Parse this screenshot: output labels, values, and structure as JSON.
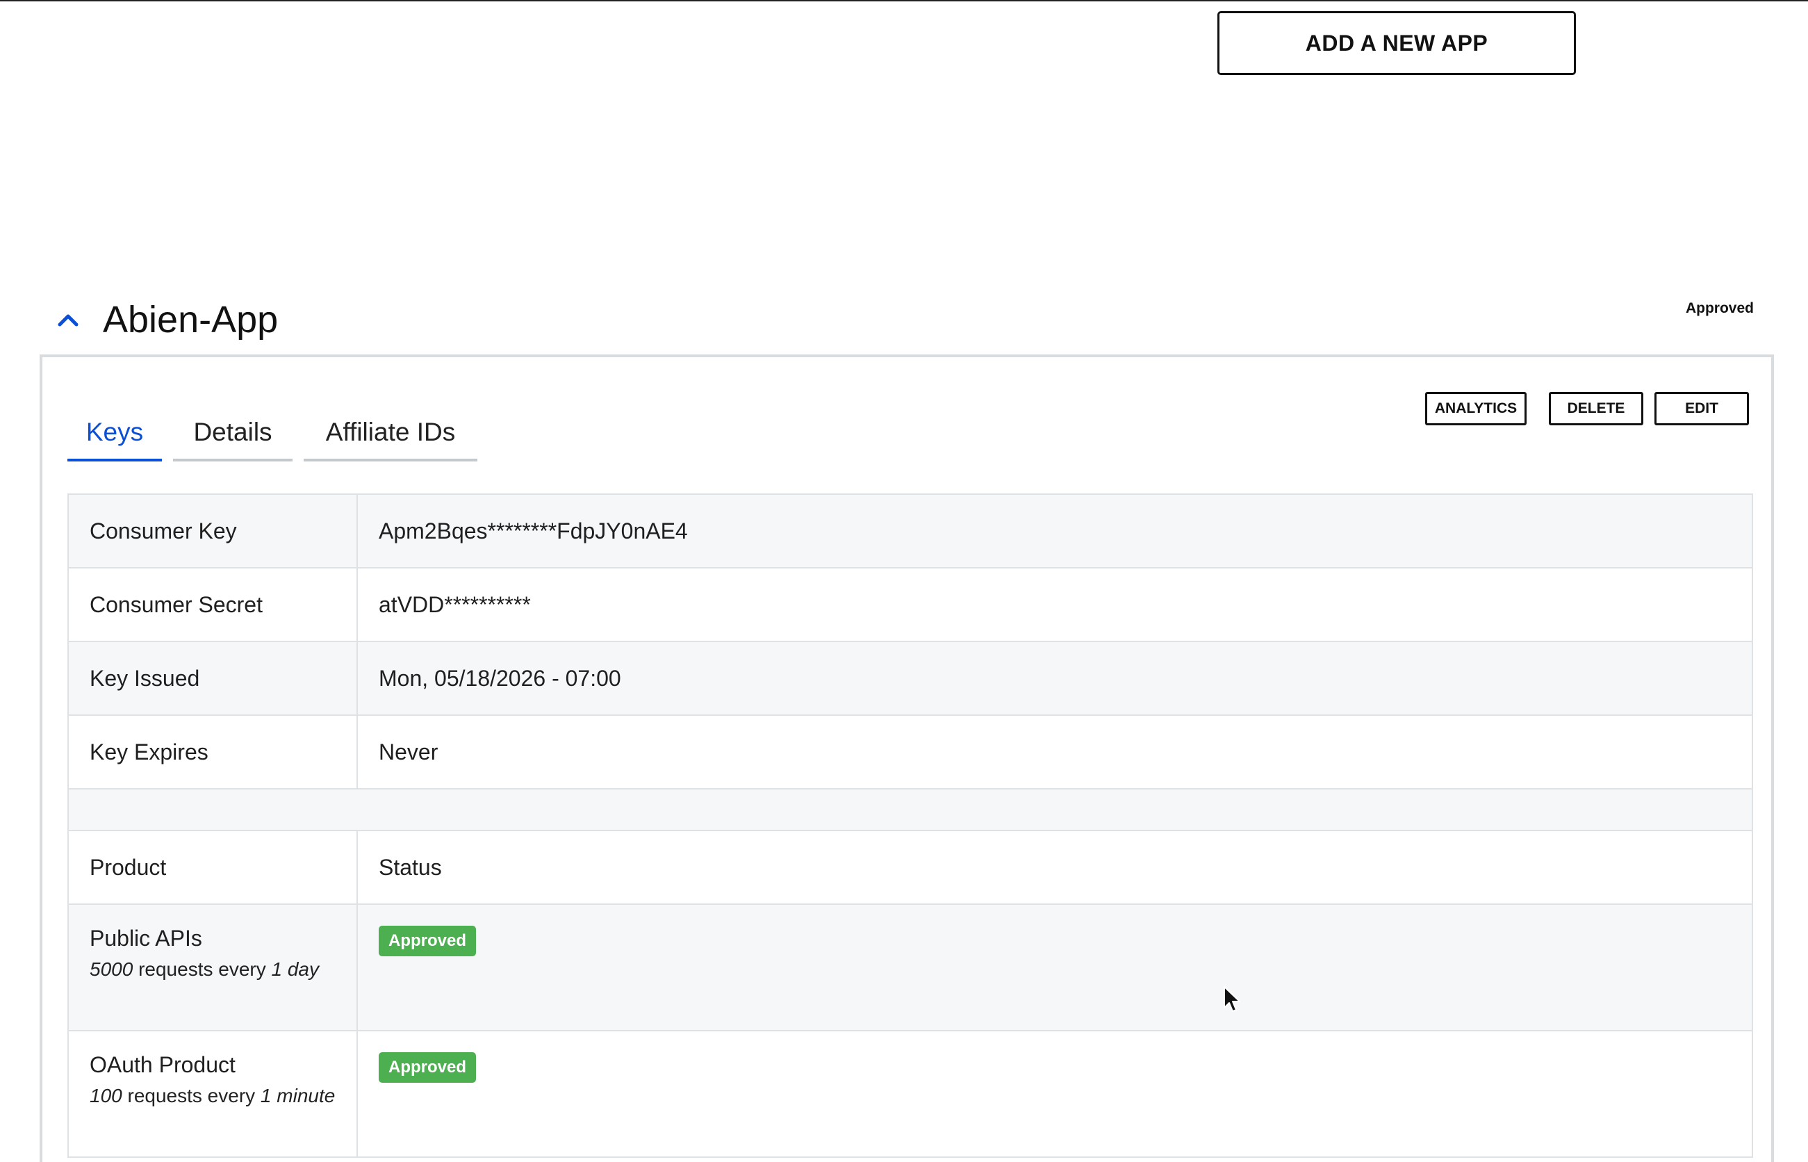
{
  "toolbar": {
    "add_app_label": "ADD A NEW APP"
  },
  "app": {
    "name": "Abien-App",
    "status": "Approved",
    "tabs": [
      {
        "label": "Keys",
        "active": true
      },
      {
        "label": "Details",
        "active": false
      },
      {
        "label": "Affiliate IDs",
        "active": false
      }
    ],
    "actions": {
      "analytics": "ANALYTICS",
      "delete": "DELETE",
      "edit": "EDIT"
    },
    "credentials": [
      {
        "label": "Consumer Key",
        "value": "Apm2Bqes********FdpJY0nAE4"
      },
      {
        "label": "Consumer Secret",
        "value": "atVDD**********"
      },
      {
        "label": "Key Issued",
        "value": "Mon, 05/18/2026 - 07:00"
      },
      {
        "label": "Key Expires",
        "value": "Never"
      }
    ],
    "products_header": {
      "product": "Product",
      "status": "Status"
    },
    "products": [
      {
        "name": "Public APIs",
        "limit_count": "5000",
        "limit_text": "requests every",
        "limit_period": "1 day",
        "status": "Approved"
      },
      {
        "name": "OAuth Product",
        "limit_count": "100",
        "limit_text": "requests every",
        "limit_period": "1 minute",
        "status": "Approved"
      }
    ]
  },
  "colors": {
    "accent": "#0b4fd6",
    "approved_badge": "#4caf50",
    "border": "#dfe2e5",
    "row_shade": "#f6f7f9"
  },
  "icons": {
    "collapse": "chevron-up-icon",
    "pointer": "mouse-cursor-icon"
  }
}
